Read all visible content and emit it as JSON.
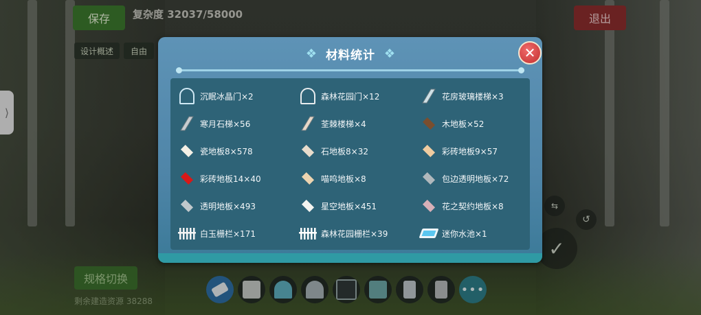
{
  "game": {
    "save_label": "保存",
    "exit_label": "退出",
    "cost_text": "复杂度 32037/58000",
    "tab_design": "设计概述",
    "tab_free": "自由",
    "spec_switch_label": "规格切换",
    "remain_text": "剩余建造资源 38288",
    "side_handle_glyph": "⟩"
  },
  "dialog": {
    "title": "材料统计",
    "close_glyph": "✕",
    "items": [
      {
        "label": "沉眠冰晶门×2",
        "icon": "crystal-gate-icon",
        "color": "#cfe8f4"
      },
      {
        "label": "森林花园门×12",
        "icon": "garden-gate-icon",
        "color": "#e8ecee"
      },
      {
        "label": "花房玻璃楼梯×3",
        "icon": "glass-stair-icon",
        "color": "#cfe0e6"
      },
      {
        "label": "寒月石梯×56",
        "icon": "stone-stair-icon",
        "color": "#c8ccd0"
      },
      {
        "label": "荃棘楼梯×4",
        "icon": "thorn-stair-icon",
        "color": "#e8d8c8"
      },
      {
        "label": "木地板×52",
        "icon": "wood-floor-icon",
        "color": "#7a4e2e"
      },
      {
        "label": "瓷地板8×578",
        "icon": "tile-floor-icon",
        "color": "#f4f0e6"
      },
      {
        "label": "石地板8×32",
        "icon": "stone-floor-icon",
        "color": "#e8dccc"
      },
      {
        "label": "彩砖地板9×57",
        "icon": "color-brick-floor-icon",
        "color": "#f0cca0"
      },
      {
        "label": "彩砖地板14×40",
        "icon": "red-brick-floor-icon",
        "color": "#d81818"
      },
      {
        "label": "喵呜地板×8",
        "icon": "meow-floor-icon",
        "color": "#ecd4b0"
      },
      {
        "label": "包边透明地板×72",
        "icon": "edged-glass-floor-icon",
        "color": "#b0b8bc"
      },
      {
        "label": "透明地板×493",
        "icon": "glass-floor-icon",
        "color": "#c0c8cc"
      },
      {
        "label": "星空地板×451",
        "icon": "starry-floor-icon",
        "color": "#f4f4f0"
      },
      {
        "label": "花之契约地板×8",
        "icon": "flower-floor-icon",
        "color": "#d8b0b8"
      },
      {
        "label": "白玉栅栏×171",
        "icon": "jade-fence-icon",
        "color": "#f4f4f4"
      },
      {
        "label": "森林花园栅栏×39",
        "icon": "garden-fence-icon",
        "color": "#ffffff"
      },
      {
        "label": "迷你水池×1",
        "icon": "mini-pool-icon",
        "color": "#5ac6f0"
      }
    ]
  },
  "toolbar": {
    "items": [
      "eraser-icon",
      "wall-icon",
      "arch-gate-icon",
      "window-icon",
      "frame-icon",
      "pillar-icon",
      "door-icon",
      "panel-icon"
    ],
    "more_glyph": "•••"
  }
}
